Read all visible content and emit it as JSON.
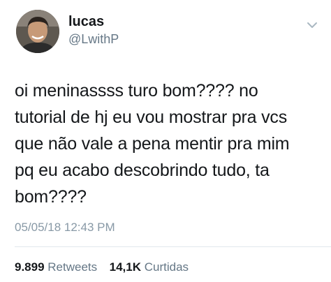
{
  "user": {
    "name": "lucas",
    "handle": "@LwithP"
  },
  "icons": {
    "avatar": "profile-photo",
    "chevron": "chevron-down-icon"
  },
  "tweet": {
    "text": "oi meninassss turo bom???? no\ntutorial de hj eu vou mostrar pra vcs\nque não vale a pena mentir pra mim\npq eu acabo descobrindo tudo, ta\nbom????",
    "timestamp": "05/05/18 12:43 PM"
  },
  "stats": {
    "retweets_count": "9.899",
    "retweets_label": "Retweets",
    "likes_count": "14,1K",
    "likes_label": "Curtidas"
  },
  "colors": {
    "text": "#14171a",
    "secondary": "#657786",
    "timestamp": "#8899a6",
    "divider": "#e1e8ed"
  }
}
